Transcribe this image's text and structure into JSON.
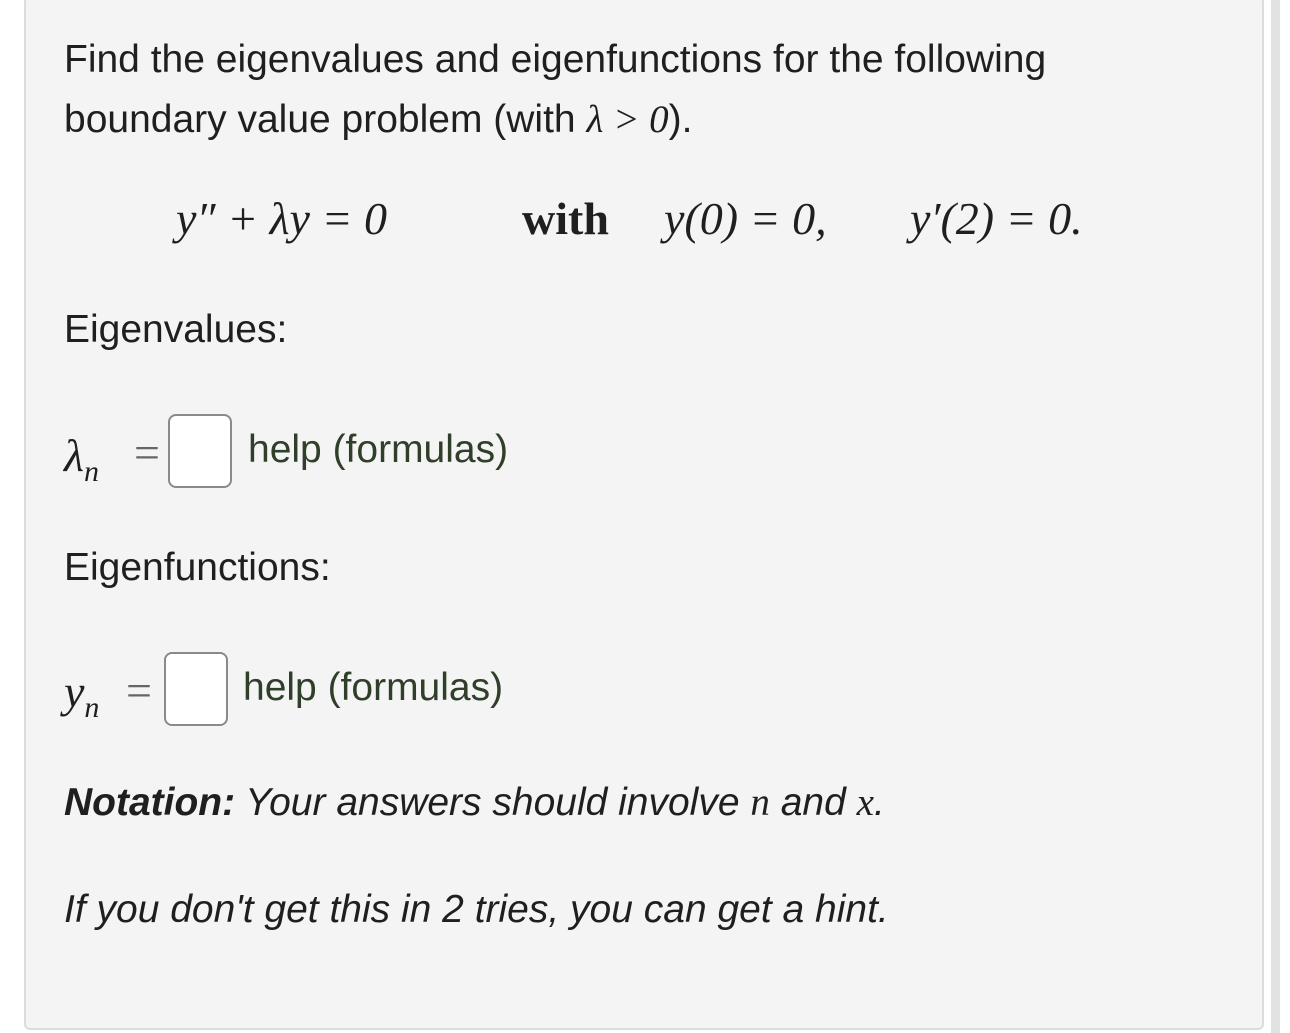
{
  "problem": {
    "prompt_line1": "Find the eigenvalues and eigenfunctions for the following",
    "prompt_line2_text": "boundary value problem (with ",
    "prompt_line2_math": "λ > 0",
    "prompt_line2_open": "",
    "prompt_line2_close": ").",
    "equation_lhs": "y″ + λy = 0",
    "equation_with": "with",
    "bc1": "y(0) = 0,",
    "bc2": "y′(2) = 0."
  },
  "eigenvalues": {
    "label": "Eigenvalues:",
    "symbol_main": "λ",
    "symbol_sub": "n",
    "equals": "=",
    "input_value": "",
    "help_text": "help (formulas)"
  },
  "eigenfunctions": {
    "label": "Eigenfunctions:",
    "symbol_main": "y",
    "symbol_sub": "n",
    "equals": "=",
    "input_value": "",
    "help_text": "help (formulas)"
  },
  "notation": {
    "bold": "Notation:",
    "text_before": " Your answers should involve ",
    "var1": "n",
    "text_mid": " and ",
    "var2": "x",
    "text_after": "."
  },
  "hint_text": "If you don't get this in 2 tries, you can get a hint."
}
